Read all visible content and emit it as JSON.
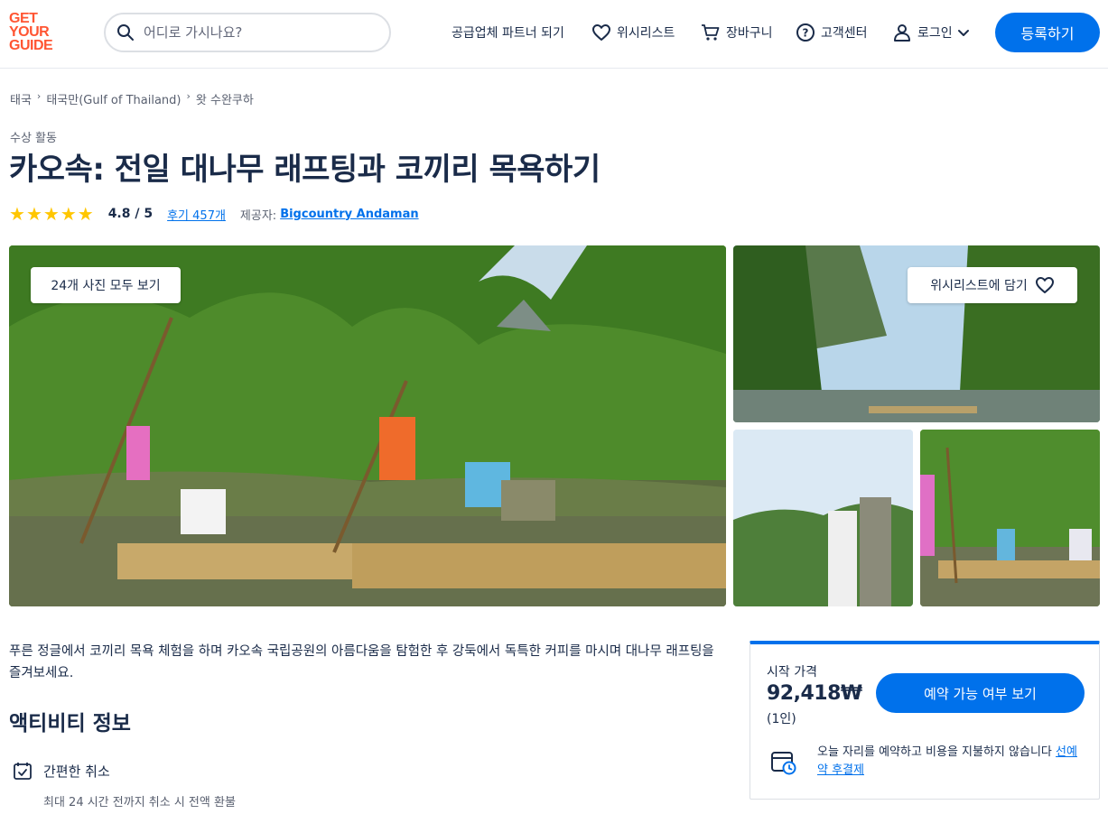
{
  "header": {
    "logo_lines": [
      "GET",
      "YOUR",
      "GUIDE"
    ],
    "search_placeholder": "어디로 가시나요?",
    "nav": {
      "partner": "공급업체 파트너 되기",
      "wishlist": "위시리스트",
      "cart": "장바구니",
      "support": "고객센터",
      "login": "로그인"
    },
    "register_label": "등록하기"
  },
  "breadcrumb": [
    "태국",
    "태국만(Gulf of Thailand)",
    "왓 수완쿠하"
  ],
  "category": "수상 활동",
  "title": "카오속: 전일 대나무 래프팅과 코끼리 목욕하기",
  "rating": {
    "stars": 5,
    "value": "4.8 / 5",
    "reviews": "후기 457개",
    "provider_label": "제공자:",
    "provider": "Bigcountry Andaman"
  },
  "gallery": {
    "all_photos_label": "24개 사진 모두 보기",
    "wishlist_label": "위시리스트에 담기"
  },
  "description": "푸른 정글에서 코끼리 목욕 체험을 하며 카오속 국립공원의 아름다움을 탐험한 후 강둑에서 독특한 커피를 마시며 대나무 래프팅을 즐겨보세요.",
  "activity_info": {
    "title": "액티비티 정보",
    "feature_title": "간편한 취소",
    "feature_sub": "최대 24 시간 전까지 취소 시 전액 환불"
  },
  "booking": {
    "price_label": "시작 가격",
    "price": "92,418₩",
    "per": "(1인)",
    "check_label": "예약 가능 여부 보기",
    "reserve_text": "오늘 자리를 예약하고 비용을 지불하지 않습니다",
    "reserve_link": "선예약 후결제"
  },
  "colors": {
    "brand": "#ff5533",
    "primary": "#0071eb",
    "star": "#ffc600",
    "text": "#1a2b49"
  }
}
